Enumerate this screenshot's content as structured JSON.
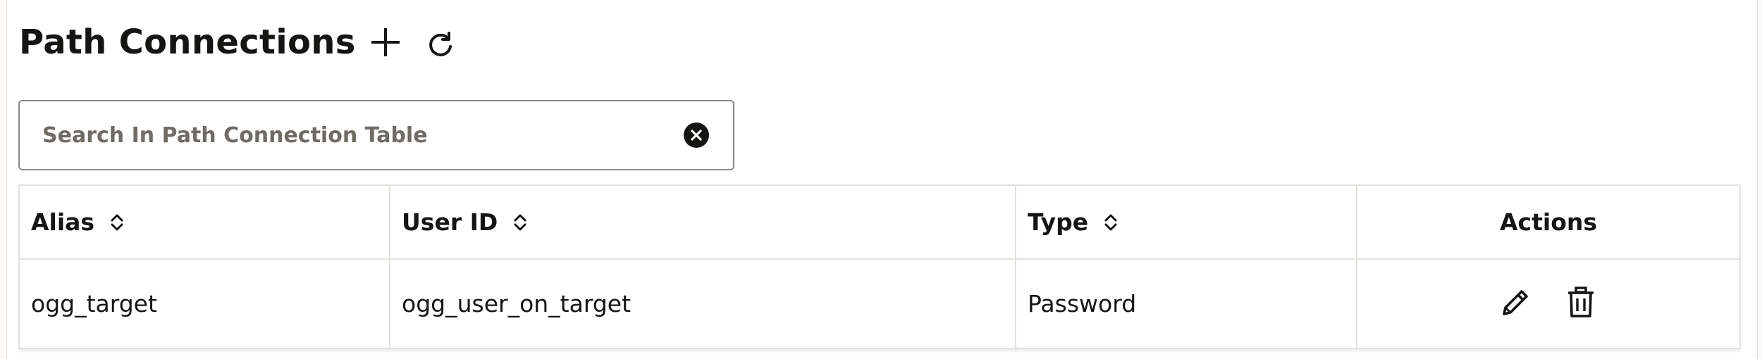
{
  "page": {
    "title": "Path Connections"
  },
  "toolbar": {
    "add_icon": "plus-icon",
    "refresh_icon": "refresh-icon"
  },
  "search": {
    "placeholder": "Search In Path Connection Table",
    "value": "",
    "clear_icon": "clear-circle-icon"
  },
  "table": {
    "columns": [
      {
        "label": "Alias",
        "sortable": true
      },
      {
        "label": "User ID",
        "sortable": true
      },
      {
        "label": "Type",
        "sortable": true
      },
      {
        "label": "Actions",
        "sortable": false
      }
    ],
    "rows": [
      {
        "alias": "ogg_target",
        "user_id": "ogg_user_on_target",
        "type": "Password",
        "actions": [
          "edit-icon",
          "delete-icon"
        ]
      }
    ]
  },
  "colors": {
    "text": "#161513",
    "border": "#e4e1dd",
    "input_border": "#8d8984",
    "placeholder": "#6f6b67"
  }
}
